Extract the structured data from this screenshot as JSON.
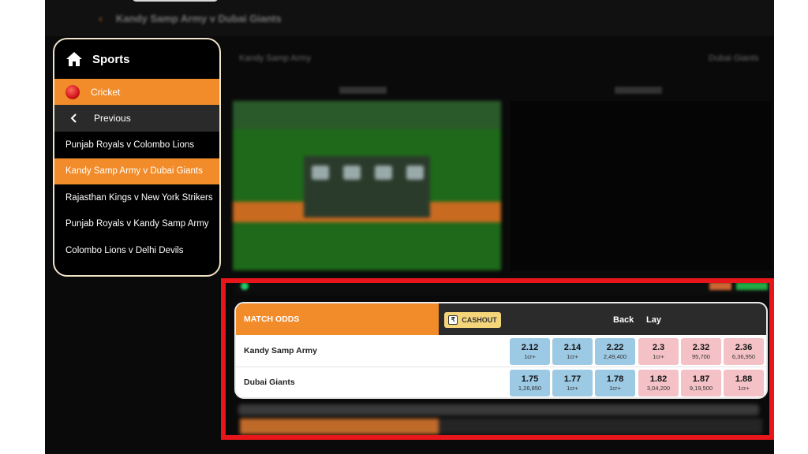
{
  "header": {
    "back_glyph": "‹",
    "title": "Kandy Samp Army v Dubai Giants"
  },
  "sports_menu": {
    "title": "Sports",
    "sport": "Cricket",
    "previous": "Previous",
    "matches": [
      {
        "label": "Punjab Royals v Colombo Lions",
        "active": false
      },
      {
        "label": "Kandy Samp Army v Dubai Giants",
        "active": true
      },
      {
        "label": "Rajasthan Kings v New York Strikers",
        "active": false
      },
      {
        "label": "Punjab Royals v Kandy Samp Army",
        "active": false
      },
      {
        "label": "Colombo Lions v Delhi Devils",
        "active": false
      }
    ]
  },
  "match_header": {
    "home_team": "Kandy Samp Army",
    "away_team": "Dubai Giants"
  },
  "market": {
    "title": "MATCH ODDS",
    "cashout_label": "CASHOUT",
    "back_label": "Back",
    "lay_label": "Lay",
    "runners": [
      {
        "name": "Kandy Samp Army",
        "back": [
          {
            "price": "2.12",
            "size": "1cr+"
          },
          {
            "price": "2.14",
            "size": "1cr+"
          },
          {
            "price": "2.22",
            "size": "2,49,400"
          }
        ],
        "lay": [
          {
            "price": "2.3",
            "size": "1cr+"
          },
          {
            "price": "2.32",
            "size": "95,700"
          },
          {
            "price": "2.36",
            "size": "6,36,950"
          }
        ]
      },
      {
        "name": "Dubai Giants",
        "back": [
          {
            "price": "1.75",
            "size": "1,26,850"
          },
          {
            "price": "1.77",
            "size": "1cr+"
          },
          {
            "price": "1.78",
            "size": "1cr+"
          }
        ],
        "lay": [
          {
            "price": "1.82",
            "size": "3,04,200"
          },
          {
            "price": "1.87",
            "size": "9,19,500"
          },
          {
            "price": "1.88",
            "size": "1cr+"
          }
        ]
      }
    ]
  },
  "colors": {
    "accent": "#f28c2a",
    "highlight": "#e8151a",
    "back": "#9cc9e3",
    "lay": "#f3c1c6"
  },
  "icons": {
    "home": "home-icon",
    "sport": "cricket-ball-icon",
    "previous": "chevron-left-icon",
    "cashout": "rupee-icon"
  }
}
